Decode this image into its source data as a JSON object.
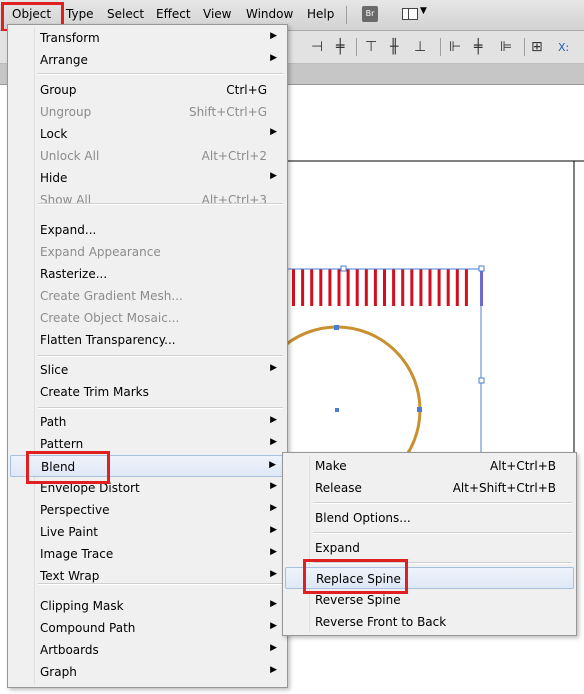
{
  "menubar": {
    "items": [
      "Object",
      "Type",
      "Select",
      "Effect",
      "View",
      "Window",
      "Help"
    ],
    "br_label": "Br"
  },
  "object_menu": {
    "items": [
      {
        "label": "Transform",
        "submenu": true
      },
      {
        "label": "Arrange",
        "submenu": true
      },
      {
        "label": "Group",
        "shortcut": "Ctrl+G"
      },
      {
        "label": "Ungroup",
        "shortcut": "Shift+Ctrl+G",
        "disabled": true
      },
      {
        "label": "Lock",
        "submenu": true
      },
      {
        "label": "Unlock All",
        "shortcut": "Alt+Ctrl+2",
        "disabled": true
      },
      {
        "label": "Hide",
        "submenu": true
      },
      {
        "label": "Show All",
        "shortcut": "Alt+Ctrl+3",
        "disabled": true
      },
      {
        "label": "Expand..."
      },
      {
        "label": "Expand Appearance",
        "disabled": true
      },
      {
        "label": "Rasterize..."
      },
      {
        "label": "Create Gradient Mesh...",
        "disabled": true
      },
      {
        "label": "Create Object Mosaic...",
        "disabled": true
      },
      {
        "label": "Flatten Transparency..."
      },
      {
        "label": "Slice",
        "submenu": true
      },
      {
        "label": "Create Trim Marks"
      },
      {
        "label": "Path",
        "submenu": true
      },
      {
        "label": "Pattern",
        "submenu": true
      },
      {
        "label": "Blend",
        "submenu": true,
        "highlighted": true
      },
      {
        "label": "Envelope Distort",
        "submenu": true
      },
      {
        "label": "Perspective",
        "submenu": true
      },
      {
        "label": "Live Paint",
        "submenu": true
      },
      {
        "label": "Image Trace",
        "submenu": true
      },
      {
        "label": "Text Wrap",
        "submenu": true
      },
      {
        "label": "Clipping Mask",
        "submenu": true
      },
      {
        "label": "Compound Path",
        "submenu": true
      },
      {
        "label": "Artboards",
        "submenu": true
      },
      {
        "label": "Graph",
        "submenu": true
      }
    ]
  },
  "blend_menu": {
    "items": [
      {
        "label": "Make",
        "shortcut": "Alt+Ctrl+B"
      },
      {
        "label": "Release",
        "shortcut": "Alt+Shift+Ctrl+B"
      },
      {
        "label": "Blend Options..."
      },
      {
        "label": "Expand"
      },
      {
        "label": "Replace Spine",
        "highlighted": true
      },
      {
        "label": "Reverse Spine"
      },
      {
        "label": "Reverse Front to Back"
      }
    ]
  },
  "colors": {
    "highlight_box": "#e02020",
    "blend_stripes": "#d0101e",
    "circle_stroke": "#c8902e",
    "selection": "#4a7fd0"
  }
}
